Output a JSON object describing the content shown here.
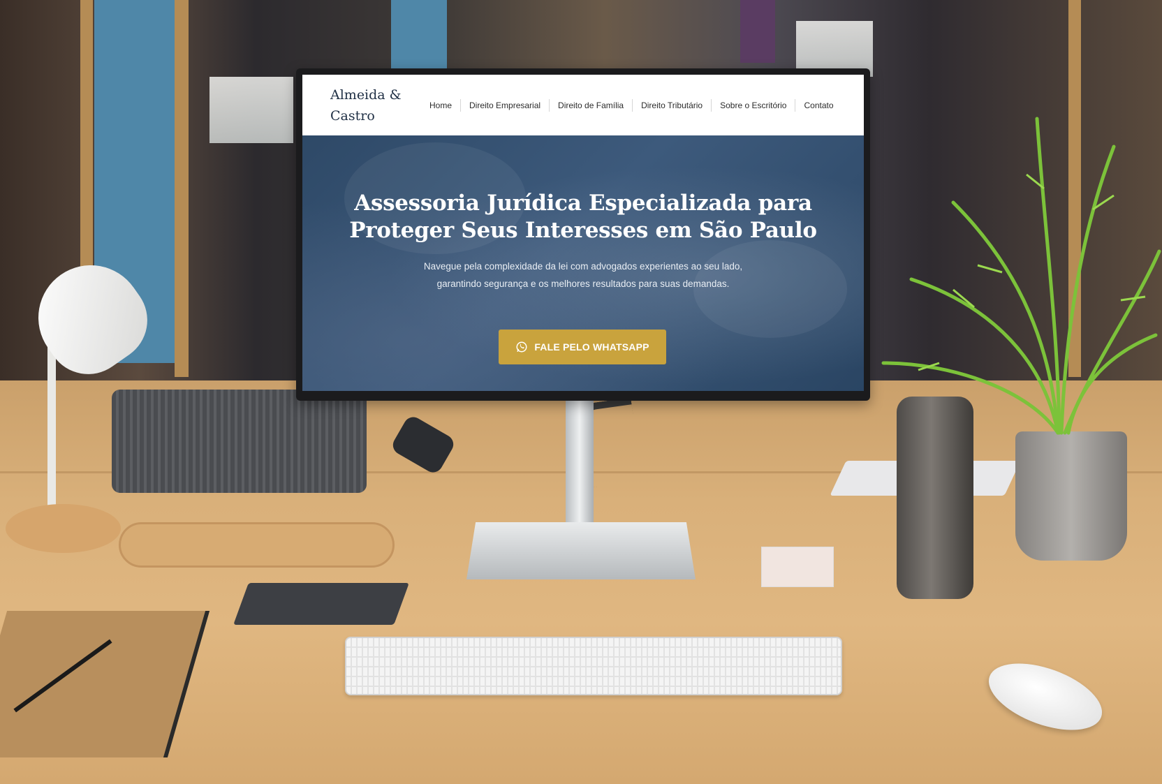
{
  "site": {
    "logo": "Almeida & Castro",
    "nav": [
      {
        "label": "Home"
      },
      {
        "label": "Direito Empresarial"
      },
      {
        "label": "Direito de Família"
      },
      {
        "label": "Direito Tributário"
      },
      {
        "label": "Sobre o Escritório"
      },
      {
        "label": "Contato"
      }
    ],
    "hero": {
      "title_line1": "Assessoria Jurídica Especializada para",
      "title_line2": "Proteger Seus Interesses em São Paulo",
      "subtitle": "Navegue pela complexidade da lei com advogados experientes ao seu lado, garantindo segurança e os melhores resultados para suas demandas.",
      "cta_label": "FALE PELO WHATSAPP",
      "cta_icon": "whatsapp-icon"
    }
  },
  "colors": {
    "header_bg": "#ffffff",
    "logo_text": "#1f2f44",
    "hero_bg": "#2e4967",
    "cta_bg": "#c9a33d",
    "cta_text": "#ffffff"
  }
}
